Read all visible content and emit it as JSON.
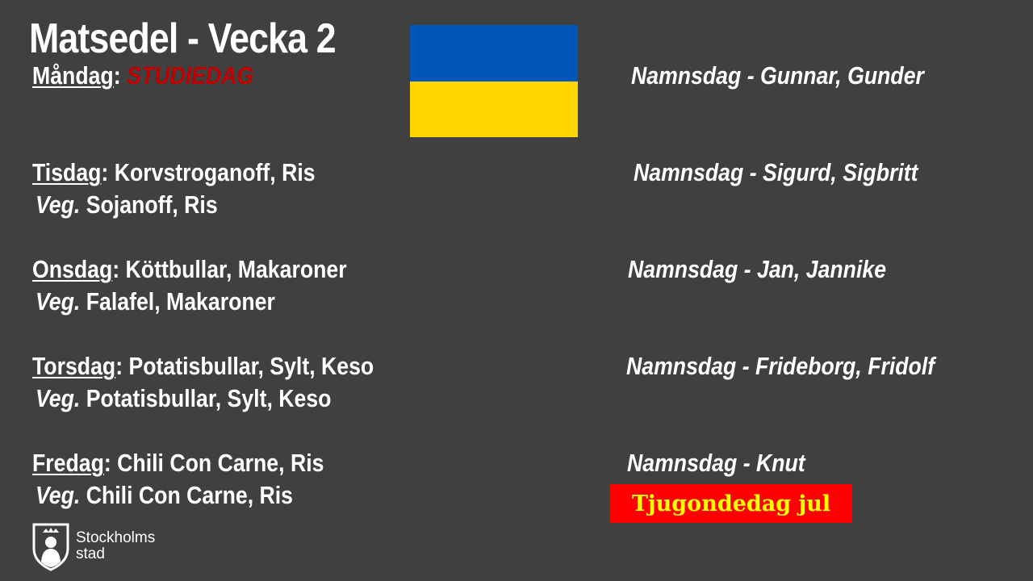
{
  "title": "Matsedel - Vecka 2",
  "days": [
    {
      "day": "Måndag",
      "menu": "STUDIEDAG",
      "menu_is_off": true,
      "veg_label": "",
      "veg": "",
      "namnsdag": "Namnsdag - Gunnar, Gunder"
    },
    {
      "day": "Tisdag",
      "menu": "Korvstroganoff, Ris",
      "veg_label": "Veg.",
      "veg": "Sojanoff, Ris",
      "namnsdag": "Namnsdag - Sigurd, Sigbritt"
    },
    {
      "day": "Onsdag",
      "menu": "Köttbullar, Makaroner",
      "veg_label": "Veg.",
      "veg": "Falafel, Makaroner",
      "namnsdag": "Namnsdag - Jan, Jannike"
    },
    {
      "day": "Torsdag",
      "menu": "Potatisbullar, Sylt, Keso",
      "veg_label": "Veg.",
      "veg": "Potatisbullar, Sylt, Keso",
      "namnsdag": "Namnsdag - Frideborg, Fridolf"
    },
    {
      "day": "Fredag",
      "menu": "Chili Con Carne, Ris",
      "veg_label": "Veg.",
      "veg": "Chili Con Carne, Ris",
      "namnsdag": "Namnsdag - Knut"
    }
  ],
  "holiday": {
    "text": "Tjugondedag jul",
    "bg": "#ff0000",
    "color": "#ffff00"
  },
  "flag": {
    "top_color": "#0057b7",
    "bottom_color": "#ffd700"
  },
  "logo": {
    "line1": "Stockholms",
    "line2": "stad",
    "icon": "stockholm-crest-icon"
  },
  "colors": {
    "background": "#404040",
    "text": "#ffffff",
    "off_day": "#c00000"
  }
}
